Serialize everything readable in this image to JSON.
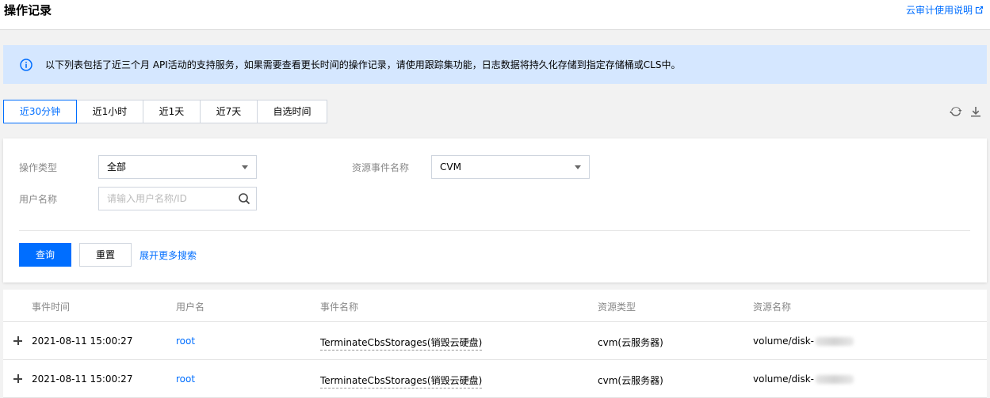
{
  "header": {
    "title": "操作记录",
    "doc_link": "云审计使用说明"
  },
  "notice": {
    "text": "以下列表包括了近三个月 API活动的支持服务，如果需要查看更长时间的操作记录，请使用跟踪集功能，日志数据将持久化存储到指定存储桶或CLS中。"
  },
  "time_tabs": [
    "近30分钟",
    "近1小时",
    "近1天",
    "近7天",
    "自选时间"
  ],
  "time_tabs_active": 0,
  "filter": {
    "op_type_label": "操作类型",
    "op_type_value": "全部",
    "resource_event_label": "资源事件名称",
    "resource_event_value": "CVM",
    "username_label": "用户名称",
    "username_placeholder": "请输入用户名称/ID",
    "query_button": "查询",
    "reset_button": "重置",
    "more_search": "展开更多搜索"
  },
  "table": {
    "columns": [
      "事件时间",
      "用户名",
      "事件名称",
      "资源类型",
      "资源名称"
    ],
    "rows": [
      {
        "time": "2021-08-11 15:00:27",
        "user": "root",
        "event": "TerminateCbsStorages(销毁云硬盘)",
        "resource_type": "cvm(云服务器)",
        "resource_name": "volume/disk-"
      },
      {
        "time": "2021-08-11 15:00:27",
        "user": "root",
        "event": "TerminateCbsStorages(销毁云硬盘)",
        "resource_type": "cvm(云服务器)",
        "resource_name": "volume/disk-"
      }
    ]
  },
  "colors": {
    "accent": "#006eff",
    "notice_bg": "#d5e7ff"
  },
  "icons": {
    "info": "info-icon",
    "external": "external-link-icon",
    "refresh": "refresh-icon",
    "download": "download-icon",
    "search": "search-icon",
    "expand": "plus-icon"
  }
}
